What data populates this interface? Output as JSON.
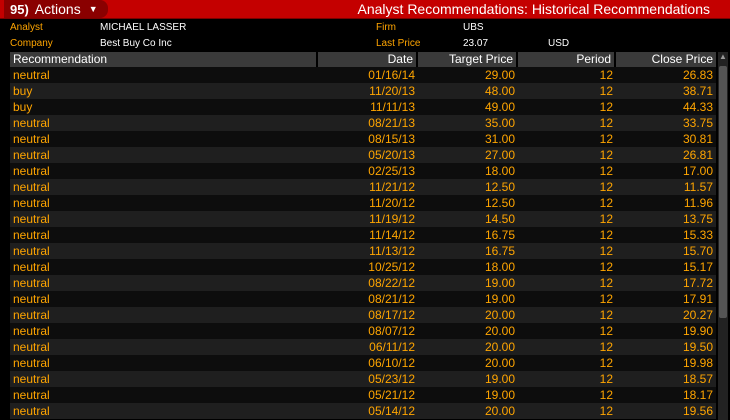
{
  "titlebar": {
    "actions_code": "95)",
    "actions_label": "Actions",
    "title": "Analyst Recommendations: Historical Recommendations"
  },
  "info": {
    "analyst_label": "Analyst",
    "analyst_value": "MICHAEL LASSER",
    "company_label": "Company",
    "company_value": "Best Buy Co Inc",
    "firm_label": "Firm",
    "firm_value": "UBS",
    "lastprice_label": "Last Price",
    "lastprice_value": "23.07",
    "currency": "USD"
  },
  "table": {
    "headers": [
      "Recommendation",
      "Date",
      "Target Price",
      "Period",
      "Close Price"
    ],
    "rows": [
      [
        "neutral",
        "01/16/14",
        "29.00",
        "12",
        "26.83"
      ],
      [
        "buy",
        "11/20/13",
        "48.00",
        "12",
        "38.71"
      ],
      [
        "buy",
        "11/11/13",
        "49.00",
        "12",
        "44.33"
      ],
      [
        "neutral",
        "08/21/13",
        "35.00",
        "12",
        "33.75"
      ],
      [
        "neutral",
        "08/15/13",
        "31.00",
        "12",
        "30.81"
      ],
      [
        "neutral",
        "05/20/13",
        "27.00",
        "12",
        "26.81"
      ],
      [
        "neutral",
        "02/25/13",
        "18.00",
        "12",
        "17.00"
      ],
      [
        "neutral",
        "11/21/12",
        "12.50",
        "12",
        "11.57"
      ],
      [
        "neutral",
        "11/20/12",
        "12.50",
        "12",
        "11.96"
      ],
      [
        "neutral",
        "11/19/12",
        "14.50",
        "12",
        "13.75"
      ],
      [
        "neutral",
        "11/14/12",
        "16.75",
        "12",
        "15.33"
      ],
      [
        "neutral",
        "11/13/12",
        "16.75",
        "12",
        "15.70"
      ],
      [
        "neutral",
        "10/25/12",
        "18.00",
        "12",
        "15.17"
      ],
      [
        "neutral",
        "08/22/12",
        "19.00",
        "12",
        "17.72"
      ],
      [
        "neutral",
        "08/21/12",
        "19.00",
        "12",
        "17.91"
      ],
      [
        "neutral",
        "08/17/12",
        "20.00",
        "12",
        "20.27"
      ],
      [
        "neutral",
        "08/07/12",
        "20.00",
        "12",
        "19.90"
      ],
      [
        "neutral",
        "06/11/12",
        "20.00",
        "12",
        "19.50"
      ],
      [
        "neutral",
        "06/10/12",
        "20.00",
        "12",
        "19.98"
      ],
      [
        "neutral",
        "05/23/12",
        "19.00",
        "12",
        "18.57"
      ],
      [
        "neutral",
        "05/21/12",
        "19.00",
        "12",
        "18.17"
      ],
      [
        "neutral",
        "05/14/12",
        "20.00",
        "12",
        "19.56"
      ]
    ]
  }
}
